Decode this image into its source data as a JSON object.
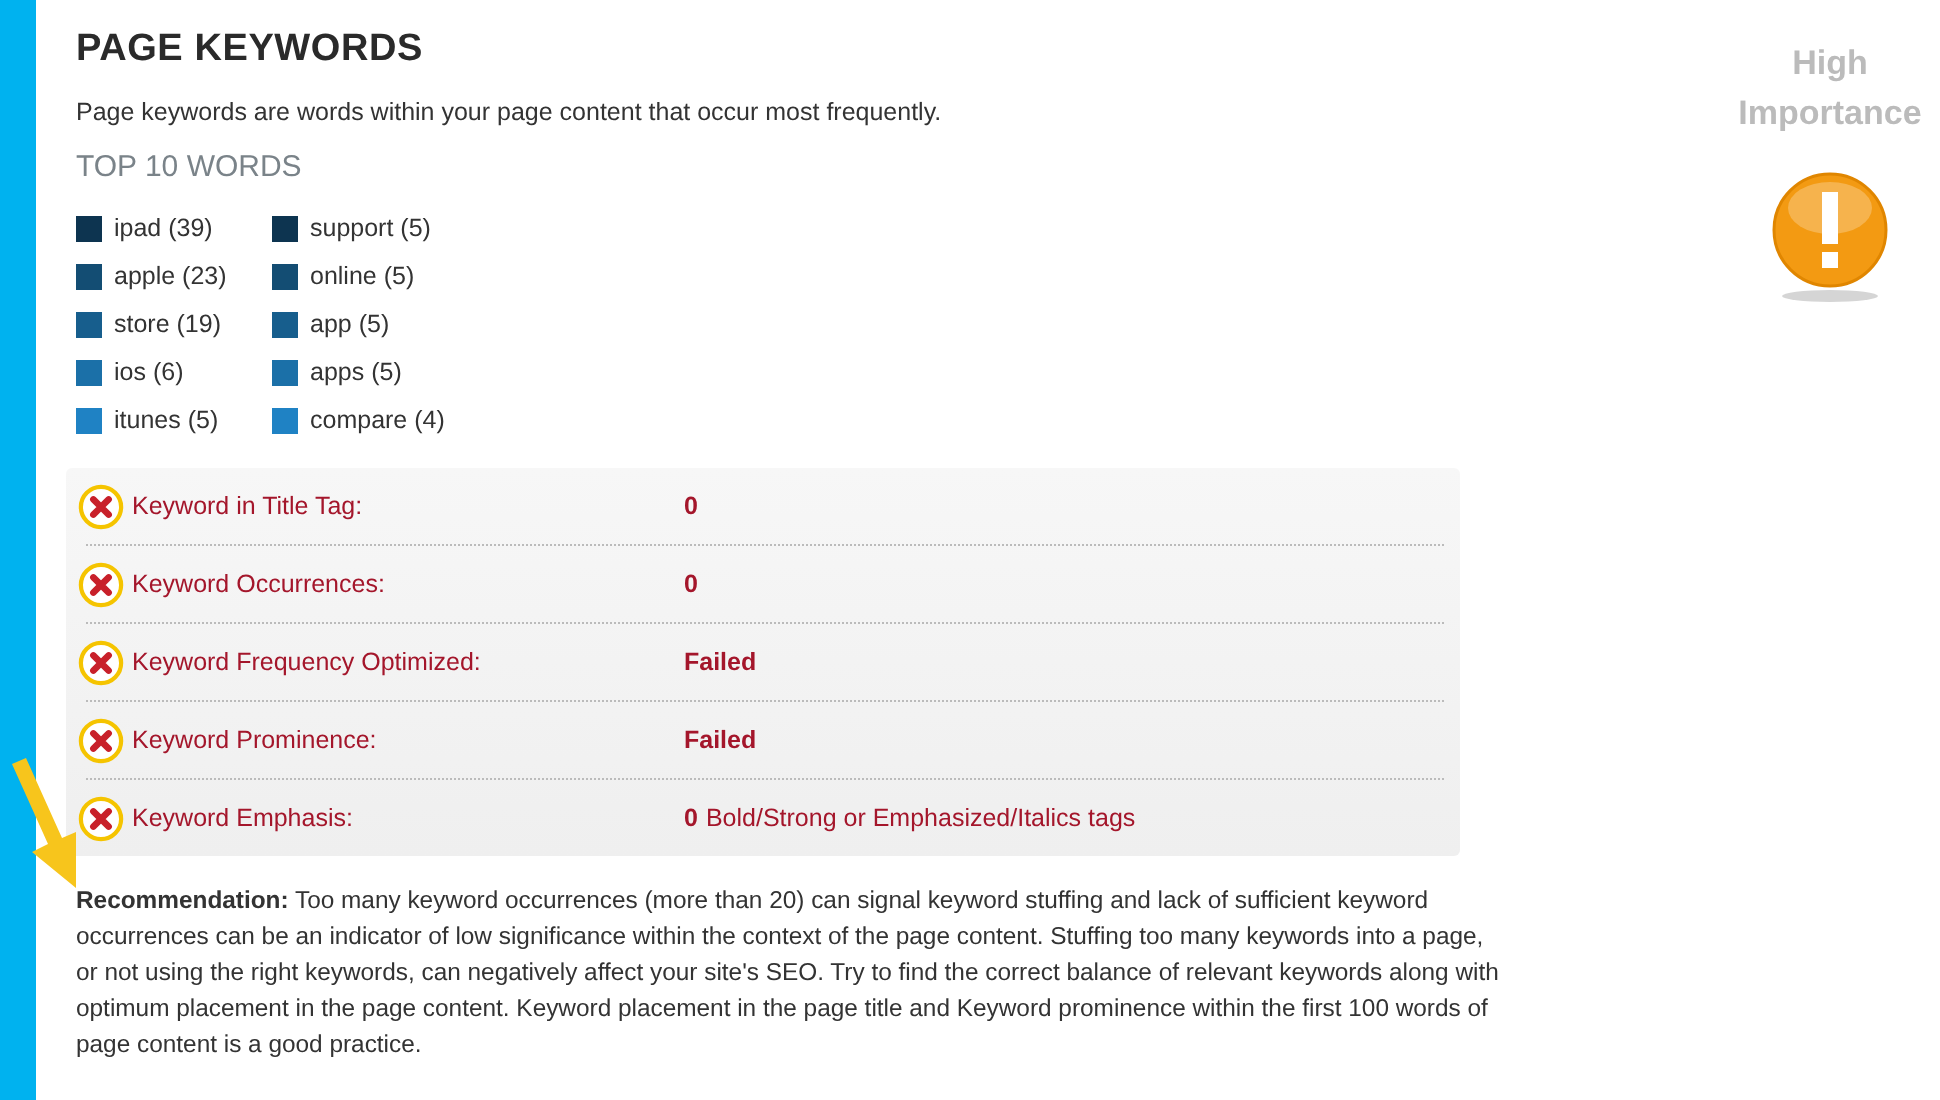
{
  "title": "PAGE KEYWORDS",
  "description": "Page keywords are words within your page content that occur most frequently.",
  "top_words": {
    "heading": "TOP 10 WORDS",
    "words": [
      {
        "label": "ipad (39)",
        "color": "#0d3450"
      },
      {
        "label": "apple (23)",
        "color": "#134d73"
      },
      {
        "label": "store (19)",
        "color": "#175e8d"
      },
      {
        "label": "ios (6)",
        "color": "#1b70a8"
      },
      {
        "label": "itunes (5)",
        "color": "#1f82c4"
      },
      {
        "label": "support (5)",
        "color": "#0d3450"
      },
      {
        "label": "online (5)",
        "color": "#134d73"
      },
      {
        "label": "app (5)",
        "color": "#175e8d"
      },
      {
        "label": "apps (5)",
        "color": "#1b70a8"
      },
      {
        "label": "compare (4)",
        "color": "#1f82c4"
      }
    ]
  },
  "checks": [
    {
      "label": "Keyword in Title Tag:",
      "passed": false,
      "value": "0"
    },
    {
      "label": "Keyword Occurrences:",
      "passed": false,
      "value": "0"
    },
    {
      "label": "Keyword Frequency Optimized:",
      "passed": false,
      "value": "Failed"
    },
    {
      "label": "Keyword Prominence:",
      "passed": false,
      "value": "Failed"
    },
    {
      "label": "Keyword Emphasis:",
      "passed": false,
      "value": "0",
      "note": "Bold/Strong or Emphasized/Italics tags"
    }
  ],
  "recommendation": "**Recommendation:** Too many keyword occurrences (more than 20) can signal keyword stuffing and lack of sufficient keyword occurrences can be an indicator of low significance within the context of the page content. Stuffing too many keywords into a page, or not using the right keywords, can negatively affect your site's SEO. Try to find the correct balance of relevant keywords along with optimum placement in the page content. Keyword placement in the page title and Keyword prominence within the first 100 words of page content is a good practice.",
  "importance": {
    "label": "High Importance"
  }
}
